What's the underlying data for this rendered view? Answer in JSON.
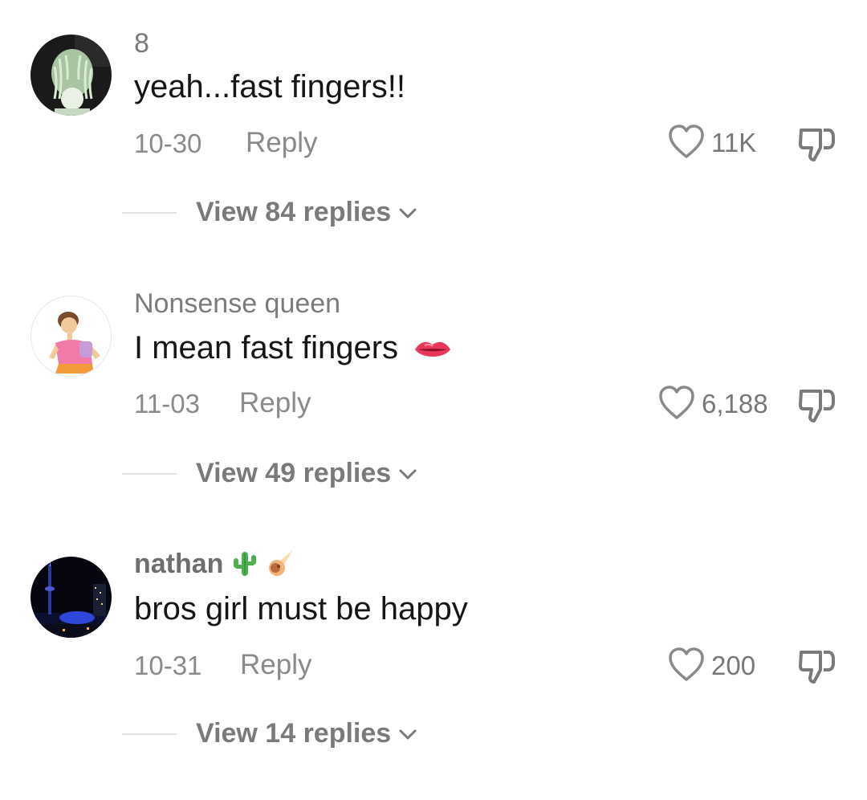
{
  "comments": [
    {
      "username": "8",
      "text": "yeah...fast fingers!!",
      "date": "10-30",
      "reply_label": "Reply",
      "likes": "11K",
      "view_replies": "View 84 replies",
      "avatar_icon": "person-avatar-icon"
    },
    {
      "username": "Nonsense queen",
      "text": "I mean fast fingers",
      "text_emoji": "lips-emoji-icon",
      "date": "11-03",
      "reply_label": "Reply",
      "likes": "6,188",
      "view_replies": "View 49 replies",
      "avatar_icon": "cartoon-avatar-icon"
    },
    {
      "username": "nathan",
      "username_emojis": [
        "cactus-emoji-icon",
        "comet-emoji-icon"
      ],
      "text": "bros girl must be happy",
      "date": "10-31",
      "reply_label": "Reply",
      "likes": "200",
      "view_replies": "View 14 replies",
      "avatar_icon": "city-night-avatar-icon"
    }
  ],
  "colors": {
    "text": "#161616",
    "meta": "#8a8a8a",
    "background": "#ffffff"
  }
}
